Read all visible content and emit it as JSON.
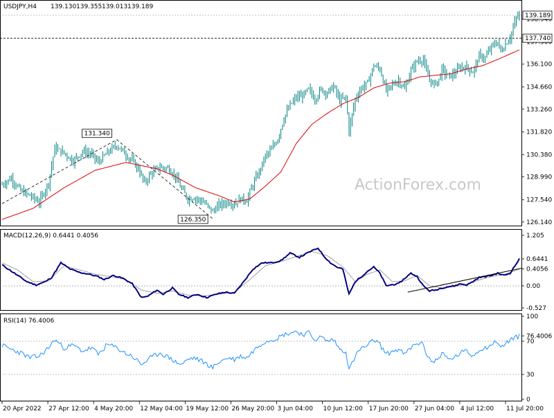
{
  "chart_data": [
    {
      "panel": "price",
      "type": "candlestick",
      "header": {
        "symbol": "USDJPY,H4",
        "open": "139.130",
        "high": "139.355",
        "low": "139.013",
        "close": "139.189"
      },
      "y_ticks": [
        "139.189",
        "138.940",
        "137.740",
        "137.500",
        "136.100",
        "134.660",
        "133.260",
        "131.820",
        "130.380",
        "128.990",
        "127.540",
        "126.140"
      ],
      "ylim": [
        126.0,
        139.8
      ],
      "current_price": "139.189",
      "hline": {
        "label": "137.740",
        "value": 137.74
      },
      "annotations": [
        {
          "label": "131.340",
          "value": 131.34
        },
        {
          "label": "126.350",
          "value": 126.35
        }
      ],
      "close_anchors": [
        [
          0,
          128.5
        ],
        [
          6,
          128.9
        ],
        [
          12,
          128.1
        ],
        [
          18,
          127.8
        ],
        [
          24,
          127.4
        ],
        [
          30,
          128.6
        ],
        [
          34,
          130.8
        ],
        [
          40,
          130.5
        ],
        [
          46,
          130.0
        ],
        [
          52,
          130.6
        ],
        [
          58,
          130.4
        ],
        [
          62,
          129.9
        ],
        [
          68,
          130.5
        ],
        [
          74,
          131.0
        ],
        [
          80,
          130.4
        ],
        [
          84,
          130.0
        ],
        [
          88,
          129.5
        ],
        [
          92,
          128.6
        ],
        [
          96,
          129.2
        ],
        [
          102,
          129.6
        ],
        [
          108,
          129.5
        ],
        [
          112,
          129.0
        ],
        [
          116,
          128.2
        ],
        [
          120,
          127.6
        ],
        [
          124,
          127.7
        ],
        [
          130,
          127.4
        ],
        [
          136,
          126.8
        ],
        [
          140,
          127.2
        ],
        [
          146,
          127.4
        ],
        [
          150,
          127.3
        ],
        [
          154,
          127.6
        ],
        [
          158,
          127.5
        ],
        [
          162,
          128.5
        ],
        [
          166,
          129.3
        ],
        [
          170,
          130.3
        ],
        [
          174,
          130.7
        ],
        [
          178,
          131.4
        ],
        [
          182,
          132.7
        ],
        [
          186,
          133.5
        ],
        [
          190,
          134.0
        ],
        [
          194,
          134.1
        ],
        [
          198,
          134.5
        ],
        [
          202,
          133.9
        ],
        [
          206,
          134.5
        ],
        [
          210,
          134.3
        ],
        [
          214,
          134.7
        ],
        [
          218,
          133.8
        ],
        [
          222,
          134.0
        ],
        [
          224,
          131.9
        ],
        [
          228,
          133.9
        ],
        [
          232,
          134.6
        ],
        [
          236,
          134.9
        ],
        [
          240,
          136.0
        ],
        [
          244,
          135.8
        ],
        [
          248,
          134.4
        ],
        [
          252,
          134.8
        ],
        [
          256,
          135.1
        ],
        [
          260,
          134.5
        ],
        [
          264,
          135.7
        ],
        [
          268,
          136.3
        ],
        [
          272,
          136.4
        ],
        [
          274,
          135.6
        ],
        [
          278,
          134.8
        ],
        [
          282,
          135.1
        ],
        [
          284,
          135.8
        ],
        [
          288,
          135.3
        ],
        [
          292,
          135.5
        ],
        [
          296,
          135.9
        ],
        [
          300,
          135.9
        ],
        [
          304,
          135.6
        ],
        [
          308,
          136.6
        ],
        [
          312,
          136.5
        ],
        [
          316,
          137.2
        ],
        [
          320,
          137.5
        ],
        [
          322,
          136.9
        ],
        [
          324,
          137.2
        ],
        [
          328,
          137.8
        ],
        [
          332,
          139.0
        ],
        [
          334,
          139.2
        ]
      ],
      "ma": [
        [
          0,
          126.3
        ],
        [
          20,
          127.0
        ],
        [
          40,
          128.3
        ],
        [
          60,
          129.4
        ],
        [
          80,
          129.9
        ],
        [
          100,
          129.5
        ],
        [
          110,
          129.1
        ],
        [
          125,
          128.3
        ],
        [
          140,
          127.8
        ],
        [
          150,
          127.4
        ],
        [
          160,
          127.6
        ],
        [
          170,
          128.4
        ],
        [
          180,
          129.3
        ],
        [
          190,
          131.1
        ],
        [
          200,
          132.3
        ],
        [
          210,
          133.0
        ],
        [
          220,
          133.6
        ],
        [
          230,
          134.0
        ],
        [
          240,
          134.6
        ],
        [
          250,
          134.9
        ],
        [
          260,
          135.0
        ],
        [
          270,
          135.3
        ],
        [
          280,
          135.4
        ],
        [
          290,
          135.5
        ],
        [
          300,
          135.8
        ],
        [
          310,
          136.0
        ],
        [
          320,
          136.4
        ],
        [
          334,
          137.0
        ]
      ],
      "trendlines": [
        {
          "from": [
            0,
            127.3
          ],
          "to": [
            74,
            131.34
          ]
        },
        {
          "from": [
            74,
            131.34
          ],
          "to": [
            136,
            126.35
          ]
        }
      ]
    },
    {
      "panel": "macd",
      "type": "line",
      "title": "MACD(12,26,9) 0.6441 0.4056",
      "y_ticks": [
        "1.205",
        "0.6441",
        "0.4056",
        "0.00",
        "-0.527"
      ],
      "ylim": [
        -0.527,
        1.205
      ],
      "current": "0.6441",
      "signal_current": "0.4056",
      "macd_anchors": [
        [
          0,
          0.5
        ],
        [
          8,
          0.3
        ],
        [
          16,
          0.1
        ],
        [
          22,
          0.02
        ],
        [
          28,
          0.1
        ],
        [
          32,
          0.2
        ],
        [
          38,
          0.55
        ],
        [
          44,
          0.4
        ],
        [
          50,
          0.32
        ],
        [
          56,
          0.28
        ],
        [
          62,
          0.22
        ],
        [
          66,
          0.15
        ],
        [
          72,
          0.25
        ],
        [
          78,
          0.18
        ],
        [
          84,
          0.05
        ],
        [
          90,
          -0.28
        ],
        [
          94,
          -0.25
        ],
        [
          100,
          -0.1
        ],
        [
          104,
          -0.2
        ],
        [
          110,
          -0.05
        ],
        [
          114,
          -0.2
        ],
        [
          120,
          -0.28
        ],
        [
          126,
          -0.2
        ],
        [
          132,
          -0.28
        ],
        [
          138,
          -0.2
        ],
        [
          144,
          -0.15
        ],
        [
          150,
          -0.18
        ],
        [
          156,
          0.1
        ],
        [
          162,
          0.4
        ],
        [
          168,
          0.55
        ],
        [
          174,
          0.55
        ],
        [
          180,
          0.6
        ],
        [
          186,
          0.78
        ],
        [
          192,
          0.68
        ],
        [
          198,
          0.8
        ],
        [
          204,
          0.9
        ],
        [
          208,
          0.7
        ],
        [
          212,
          0.55
        ],
        [
          216,
          0.45
        ],
        [
          220,
          0.4
        ],
        [
          224,
          -0.2
        ],
        [
          228,
          0.1
        ],
        [
          232,
          0.22
        ],
        [
          236,
          0.35
        ],
        [
          240,
          0.45
        ],
        [
          244,
          0.3
        ],
        [
          248,
          0.0
        ],
        [
          252,
          0.03
        ],
        [
          256,
          0.05
        ],
        [
          260,
          0.18
        ],
        [
          264,
          0.3
        ],
        [
          268,
          0.22
        ],
        [
          272,
          0.0
        ],
        [
          276,
          -0.12
        ],
        [
          280,
          -0.1
        ],
        [
          284,
          -0.05
        ],
        [
          288,
          -0.02
        ],
        [
          292,
          0.0
        ],
        [
          296,
          0.05
        ],
        [
          300,
          0.02
        ],
        [
          304,
          0.1
        ],
        [
          308,
          0.2
        ],
        [
          312,
          0.22
        ],
        [
          316,
          0.25
        ],
        [
          320,
          0.3
        ],
        [
          324,
          0.25
        ],
        [
          328,
          0.3
        ],
        [
          334,
          0.64
        ]
      ],
      "signal_anchors": [
        [
          0,
          0.55
        ],
        [
          10,
          0.38
        ],
        [
          20,
          0.1
        ],
        [
          30,
          0.12
        ],
        [
          40,
          0.48
        ],
        [
          50,
          0.38
        ],
        [
          60,
          0.28
        ],
        [
          70,
          0.22
        ],
        [
          80,
          0.15
        ],
        [
          90,
          -0.1
        ],
        [
          100,
          -0.18
        ],
        [
          110,
          -0.12
        ],
        [
          120,
          -0.22
        ],
        [
          130,
          -0.24
        ],
        [
          140,
          -0.2
        ],
        [
          150,
          -0.15
        ],
        [
          160,
          0.15
        ],
        [
          170,
          0.48
        ],
        [
          180,
          0.58
        ],
        [
          190,
          0.7
        ],
        [
          200,
          0.82
        ],
        [
          210,
          0.72
        ],
        [
          220,
          0.45
        ],
        [
          228,
          0.1
        ],
        [
          236,
          0.28
        ],
        [
          244,
          0.38
        ],
        [
          252,
          0.1
        ],
        [
          260,
          0.12
        ],
        [
          268,
          0.25
        ],
        [
          276,
          0.0
        ],
        [
          284,
          -0.05
        ],
        [
          292,
          -0.02
        ],
        [
          300,
          0.04
        ],
        [
          308,
          0.14
        ],
        [
          316,
          0.22
        ],
        [
          324,
          0.27
        ],
        [
          334,
          0.4
        ]
      ],
      "trendline": {
        "from": [
          244,
          -0.15
        ],
        "to": [
          334,
          0.32
        ]
      }
    },
    {
      "panel": "rsi",
      "type": "line",
      "title": "RSI(14) 76.4006",
      "y_ticks": [
        "100",
        "76.4006",
        "70",
        "30",
        "0"
      ],
      "ylim": [
        0,
        100
      ],
      "levels": [
        70,
        30
      ],
      "current": "76.4006",
      "rsi_anchors": [
        [
          0,
          65
        ],
        [
          6,
          60
        ],
        [
          12,
          56
        ],
        [
          18,
          50
        ],
        [
          24,
          52
        ],
        [
          30,
          62
        ],
        [
          34,
          72
        ],
        [
          40,
          62
        ],
        [
          46,
          65
        ],
        [
          52,
          58
        ],
        [
          58,
          62
        ],
        [
          62,
          54
        ],
        [
          68,
          66
        ],
        [
          74,
          62
        ],
        [
          80,
          55
        ],
        [
          84,
          52
        ],
        [
          90,
          42
        ],
        [
          96,
          50
        ],
        [
          102,
          56
        ],
        [
          108,
          50
        ],
        [
          112,
          45
        ],
        [
          116,
          42
        ],
        [
          120,
          48
        ],
        [
          124,
          50
        ],
        [
          130,
          45
        ],
        [
          136,
          38
        ],
        [
          140,
          45
        ],
        [
          146,
          50
        ],
        [
          150,
          48
        ],
        [
          154,
          52
        ],
        [
          158,
          50
        ],
        [
          162,
          58
        ],
        [
          166,
          65
        ],
        [
          170,
          70
        ],
        [
          174,
          72
        ],
        [
          178,
          74
        ],
        [
          182,
          78
        ],
        [
          186,
          80
        ],
        [
          190,
          82
        ],
        [
          194,
          78
        ],
        [
          198,
          80
        ],
        [
          202,
          72
        ],
        [
          206,
          75
        ],
        [
          210,
          70
        ],
        [
          214,
          72
        ],
        [
          218,
          60
        ],
        [
          222,
          58
        ],
        [
          224,
          35
        ],
        [
          228,
          52
        ],
        [
          232,
          62
        ],
        [
          236,
          64
        ],
        [
          240,
          72
        ],
        [
          244,
          66
        ],
        [
          248,
          54
        ],
        [
          252,
          58
        ],
        [
          256,
          60
        ],
        [
          260,
          54
        ],
        [
          264,
          62
        ],
        [
          268,
          68
        ],
        [
          272,
          66
        ],
        [
          274,
          55
        ],
        [
          278,
          44
        ],
        [
          282,
          50
        ],
        [
          284,
          56
        ],
        [
          288,
          48
        ],
        [
          292,
          50
        ],
        [
          296,
          56
        ],
        [
          300,
          58
        ],
        [
          304,
          52
        ],
        [
          308,
          60
        ],
        [
          312,
          62
        ],
        [
          316,
          66
        ],
        [
          320,
          70
        ],
        [
          322,
          62
        ],
        [
          324,
          65
        ],
        [
          328,
          72
        ],
        [
          334,
          76
        ]
      ]
    }
  ],
  "x_axis": {
    "labels": [
      "20 Apr 2022",
      "27 Apr 12:00",
      "4 May 20:00",
      "12 May 04:00",
      "19 May 12:00",
      "26 May 20:00",
      "3 Jun 04:00",
      "10 Jun 12:00",
      "17 Jun 20:00",
      "27 Jun 04:00",
      "4 Jul 12:00",
      "11 Jul 20:00"
    ],
    "bar_count": 335
  },
  "watermark": "ActionForex.com",
  "colors": {
    "candle": "#008080",
    "ma": "#e00000",
    "macd": "#000080",
    "signal": "#a0a0a0",
    "rsi": "#1e90ff",
    "tag_bg": "#ffffff"
  }
}
